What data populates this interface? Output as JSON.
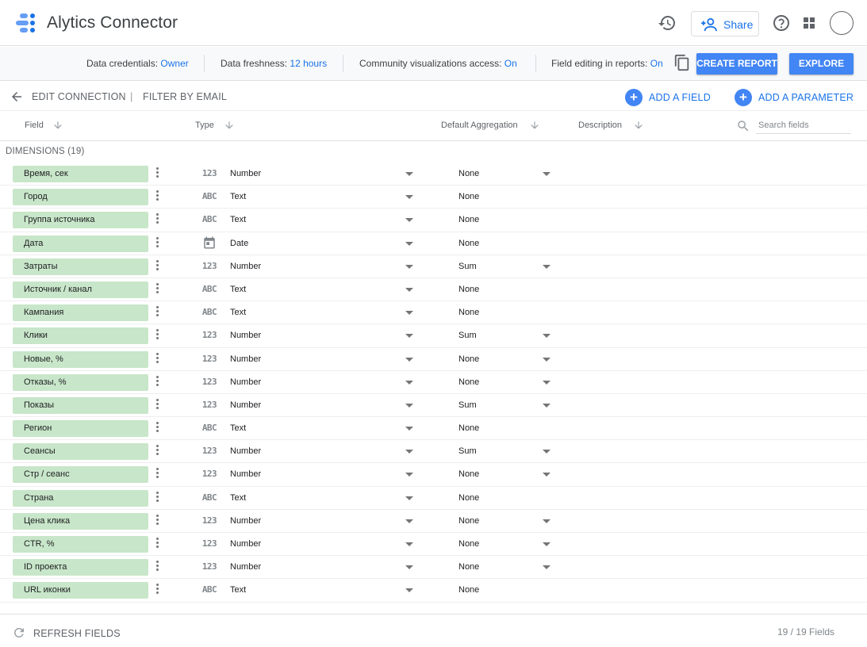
{
  "header": {
    "app_title": "Alytics Connector",
    "share_label": "Share",
    "brand_color": "#4285f4",
    "icons": [
      "history-icon",
      "share-person-add-icon",
      "help-icon",
      "apps-grid-icon",
      "avatar"
    ]
  },
  "infobar": {
    "credentials_label": "Data credentials:",
    "credentials_value": "Owner",
    "freshness_label": "Data freshness:",
    "freshness_value": "12 hours",
    "community_label": "Community visualizations access:",
    "community_value": "On",
    "field_editing_label": "Field editing in reports:",
    "field_editing_value": "On",
    "create_report_label": "CREATE REPORT",
    "explore_label": "EXPLORE"
  },
  "actionbar": {
    "edit_connection_label": "EDIT CONNECTION",
    "separator": "|",
    "filter_label": "FILTER BY EMAIL",
    "add_field_label": "ADD A FIELD",
    "add_parameter_label": "ADD A PARAMETER"
  },
  "columns": {
    "field": "Field",
    "type": "Type",
    "aggregation": "Default Aggregation",
    "description": "Description",
    "search_placeholder": "Search fields"
  },
  "section": {
    "dimensions_label": "DIMENSIONS (19)"
  },
  "fields": [
    {
      "name": "Время, сек",
      "type_icon": "123",
      "type": "Number",
      "aggregation": "None",
      "agg_dropdown": true
    },
    {
      "name": "Город",
      "type_icon": "ABC",
      "type": "Text",
      "aggregation": "None",
      "agg_dropdown": false
    },
    {
      "name": "Группа источника",
      "type_icon": "ABC",
      "type": "Text",
      "aggregation": "None",
      "agg_dropdown": false
    },
    {
      "name": "Дата",
      "type_icon": "calendar",
      "type": "Date",
      "aggregation": "None",
      "agg_dropdown": false
    },
    {
      "name": "Затраты",
      "type_icon": "123",
      "type": "Number",
      "aggregation": "Sum",
      "agg_dropdown": true
    },
    {
      "name": "Источник / канал",
      "type_icon": "ABC",
      "type": "Text",
      "aggregation": "None",
      "agg_dropdown": false
    },
    {
      "name": "Кампания",
      "type_icon": "ABC",
      "type": "Text",
      "aggregation": "None",
      "agg_dropdown": false
    },
    {
      "name": "Клики",
      "type_icon": "123",
      "type": "Number",
      "aggregation": "Sum",
      "agg_dropdown": true
    },
    {
      "name": "Новые, %",
      "type_icon": "123",
      "type": "Number",
      "aggregation": "None",
      "agg_dropdown": true
    },
    {
      "name": "Отказы, %",
      "type_icon": "123",
      "type": "Number",
      "aggregation": "None",
      "agg_dropdown": true
    },
    {
      "name": "Показы",
      "type_icon": "123",
      "type": "Number",
      "aggregation": "Sum",
      "agg_dropdown": true
    },
    {
      "name": "Регион",
      "type_icon": "ABC",
      "type": "Text",
      "aggregation": "None",
      "agg_dropdown": false
    },
    {
      "name": "Сеансы",
      "type_icon": "123",
      "type": "Number",
      "aggregation": "Sum",
      "agg_dropdown": true
    },
    {
      "name": "Стр / сеанс",
      "type_icon": "123",
      "type": "Number",
      "aggregation": "None",
      "agg_dropdown": true
    },
    {
      "name": "Страна",
      "type_icon": "ABC",
      "type": "Text",
      "aggregation": "None",
      "agg_dropdown": false
    },
    {
      "name": "Цена клика",
      "type_icon": "123",
      "type": "Number",
      "aggregation": "None",
      "agg_dropdown": true
    },
    {
      "name": "CTR, %",
      "type_icon": "123",
      "type": "Number",
      "aggregation": "None",
      "agg_dropdown": true
    },
    {
      "name": "ID проекта",
      "type_icon": "123",
      "type": "Number",
      "aggregation": "None",
      "agg_dropdown": true
    },
    {
      "name": "URL иконки",
      "type_icon": "ABC",
      "type": "Text",
      "aggregation": "None",
      "agg_dropdown": false
    }
  ],
  "footer": {
    "refresh_label": "REFRESH FIELDS",
    "field_count": "19 / 19 Fields"
  },
  "colors": {
    "accent": "#1a73e8",
    "button_blue": "#4285f4",
    "dimension_chip": "#c8e6c9"
  }
}
